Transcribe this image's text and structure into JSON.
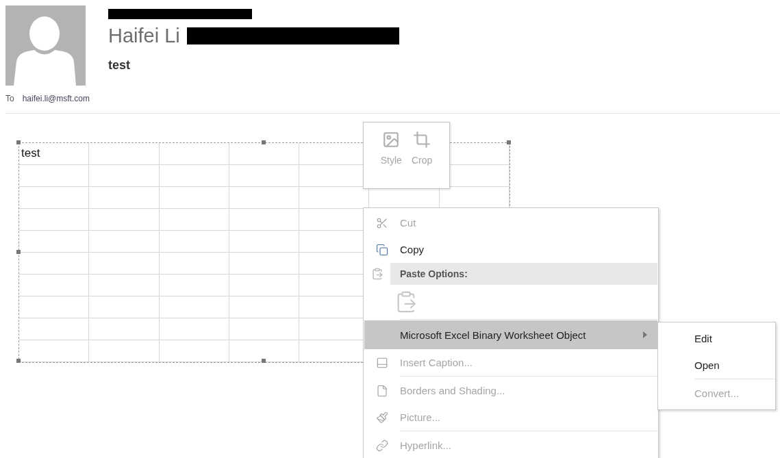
{
  "message": {
    "sender": "Haifei Li",
    "subject": "test",
    "to_label": "To",
    "to": "haifei.li@msft.com"
  },
  "embedded_sheet": {
    "cell_text": "test"
  },
  "mini_toolbar": [
    {
      "label": "Style",
      "disabled": true
    },
    {
      "label": "Crop",
      "disabled": true
    }
  ],
  "context_menu": [
    {
      "kind": "command",
      "label": "Cut",
      "disabled": true
    },
    {
      "kind": "command",
      "label": "Copy",
      "disabled": false
    },
    {
      "kind": "header",
      "label": "Paste Options:"
    },
    {
      "kind": "paste-icon"
    },
    {
      "kind": "separator"
    },
    {
      "kind": "submenu",
      "label": "Microsoft Excel Binary Worksheet Object",
      "selected": true,
      "disabled": false
    },
    {
      "kind": "command",
      "label": "Insert Caption...",
      "disabled": true
    },
    {
      "kind": "separator"
    },
    {
      "kind": "command",
      "label": "Borders and Shading...",
      "disabled": true
    },
    {
      "kind": "command",
      "label": "Picture...",
      "disabled": true
    },
    {
      "kind": "separator"
    },
    {
      "kind": "command",
      "label": "Hyperlink...",
      "disabled": true
    }
  ],
  "submenu": [
    {
      "kind": "command",
      "label": "Edit",
      "disabled": false
    },
    {
      "kind": "command",
      "label": "Open",
      "disabled": false
    },
    {
      "kind": "separator"
    },
    {
      "kind": "command",
      "label": "Convert...",
      "disabled": true
    }
  ]
}
